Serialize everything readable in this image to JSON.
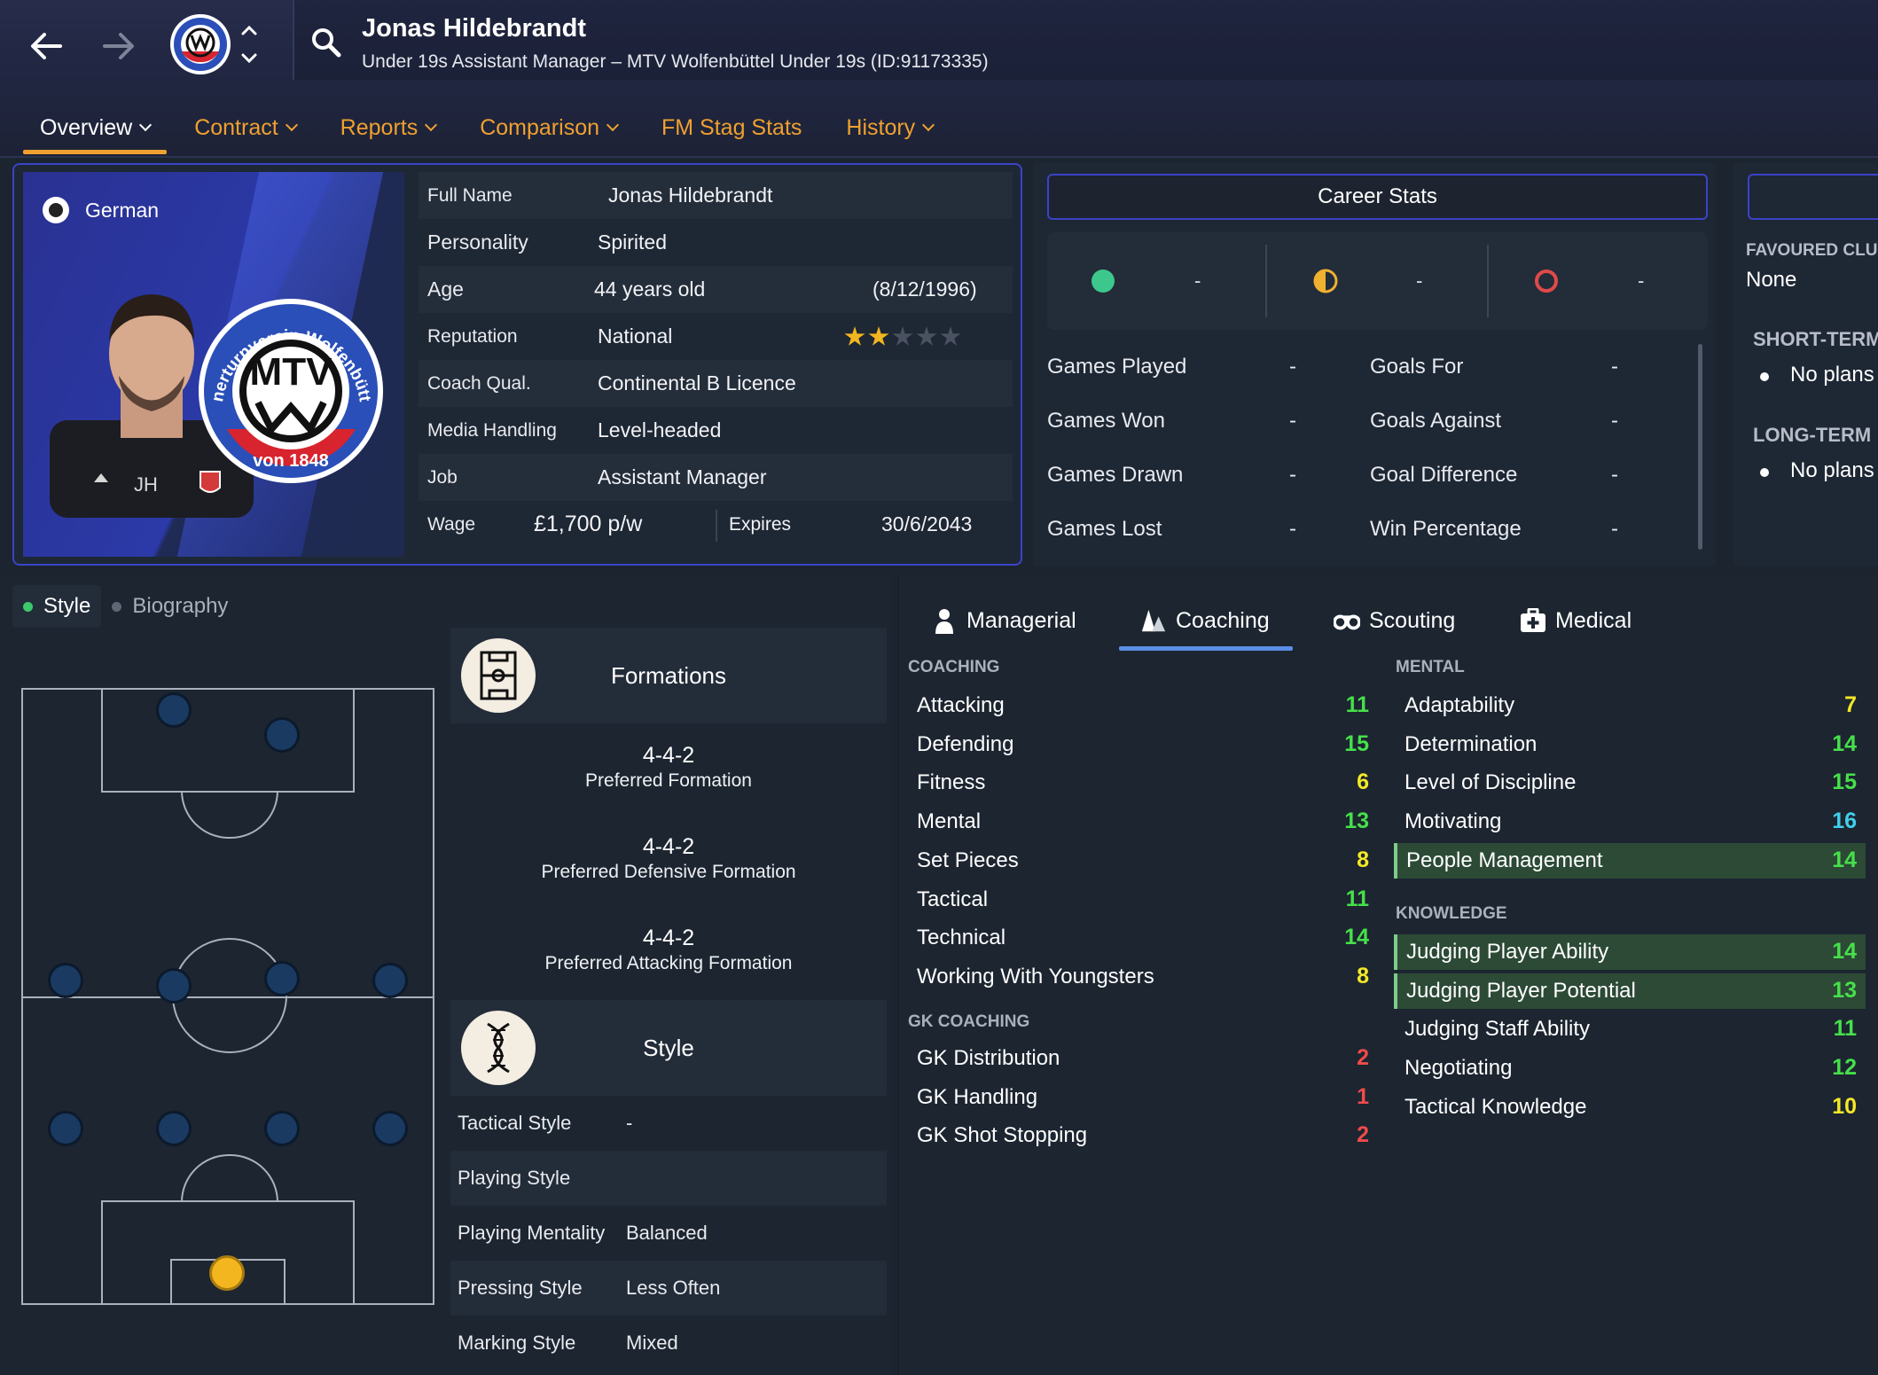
{
  "header": {
    "person_name": "Jonas Hildebrandt",
    "subtitle": "Under 19s Assistant Manager – MTV Wolfenbüttel Under 19s (ID:91173335)",
    "tabs": [
      {
        "label": "Overview",
        "dropdown": true,
        "active": true
      },
      {
        "label": "Contract",
        "dropdown": true
      },
      {
        "label": "Reports",
        "dropdown": true
      },
      {
        "label": "Comparison",
        "dropdown": true
      },
      {
        "label": "FM Stag Stats",
        "dropdown": false
      },
      {
        "label": "History",
        "dropdown": true
      }
    ],
    "accent": "#f0a030"
  },
  "profile": {
    "nationality": "German",
    "initials": "JH",
    "crest_top_text": "nerturnverein Wolfenbüttel e.V.",
    "crest_letters": "MTV",
    "crest_year": "von 1848",
    "rows": {
      "full_name_label": "Full Name",
      "full_name": "Jonas Hildebrandt",
      "personality_label": "Personality",
      "personality": "Spirited",
      "age_label": "Age",
      "age": "44 years old",
      "dob": "(8/12/1996)",
      "reputation_label": "Reputation",
      "reputation": "National",
      "reputation_stars": 2,
      "coach_qual_label": "Coach Qual.",
      "coach_qual": "Continental B Licence",
      "media_label": "Media Handling",
      "media": "Level-headed",
      "job_label": "Job",
      "job": "Assistant Manager",
      "wage_label": "Wage",
      "wage": "£1,700 p/w",
      "expires_label": "Expires",
      "expires": "30/6/2043"
    }
  },
  "career": {
    "title": "Career Stats",
    "results": [
      {
        "icon": "win-circle-icon",
        "color": "#3cc88c",
        "value": "-"
      },
      {
        "icon": "draw-circle-icon",
        "color": "#f0b030",
        "value": "-"
      },
      {
        "icon": "loss-circle-icon",
        "color": "#e04a4a",
        "value": "-"
      }
    ],
    "stats": [
      {
        "left_label": "Games Played",
        "left_value": "-",
        "right_label": "Goals For",
        "right_value": "-"
      },
      {
        "left_label": "Games Won",
        "left_value": "-",
        "right_label": "Goals Against",
        "right_value": "-"
      },
      {
        "left_label": "Games Drawn",
        "left_value": "-",
        "right_label": "Goal Difference",
        "right_value": "-"
      },
      {
        "left_label": "Games Lost",
        "left_value": "-",
        "right_label": "Win Percentage",
        "right_value": "-"
      }
    ]
  },
  "side": {
    "favoured_label": "FAVOURED CLUB",
    "favoured_value": "None",
    "short_label": "SHORT-TERM",
    "short_value": "No plans",
    "long_label": "LONG-TERM",
    "long_value": "No plans"
  },
  "style_tabs": [
    {
      "label": "Style",
      "active": true
    },
    {
      "label": "Biography",
      "active": false
    }
  ],
  "formations": {
    "title": "Formations",
    "items": [
      {
        "formation": "4-4-2",
        "desc": "Preferred Formation"
      },
      {
        "formation": "4-4-2",
        "desc": "Preferred Defensive Formation"
      },
      {
        "formation": "4-4-2",
        "desc": "Preferred Attacking Formation"
      }
    ]
  },
  "style": {
    "title": "Style",
    "rows": [
      {
        "label": "Tactical Style",
        "value": "-"
      },
      {
        "label": "Playing Style",
        "value": ""
      },
      {
        "label": "Playing Mentality",
        "value": "Balanced"
      },
      {
        "label": "Pressing Style",
        "value": "Less Often"
      },
      {
        "label": "Marking Style",
        "value": "Mixed"
      }
    ]
  },
  "attributes": {
    "tabs": [
      {
        "label": "Managerial",
        "icon": "person-icon"
      },
      {
        "label": "Coaching",
        "icon": "cones-icon",
        "active": true
      },
      {
        "label": "Scouting",
        "icon": "binoculars-icon"
      },
      {
        "label": "Medical",
        "icon": "medical-kit-icon"
      }
    ],
    "coaching_title": "COACHING",
    "coaching": [
      {
        "name": "Attacking",
        "value": 11
      },
      {
        "name": "Defending",
        "value": 15
      },
      {
        "name": "Fitness",
        "value": 6
      },
      {
        "name": "Mental",
        "value": 13
      },
      {
        "name": "Set Pieces",
        "value": 8
      },
      {
        "name": "Tactical",
        "value": 11
      },
      {
        "name": "Technical",
        "value": 14
      },
      {
        "name": "Working With Youngsters",
        "value": 8
      }
    ],
    "gk_title": "GK COACHING",
    "gk": [
      {
        "name": "GK Distribution",
        "value": 2
      },
      {
        "name": "GK Handling",
        "value": 1
      },
      {
        "name": "GK Shot Stopping",
        "value": 2
      }
    ],
    "mental_title": "MENTAL",
    "mental": [
      {
        "name": "Adaptability",
        "value": 7
      },
      {
        "name": "Determination",
        "value": 14
      },
      {
        "name": "Level of Discipline",
        "value": 15
      },
      {
        "name": "Motivating",
        "value": 16
      },
      {
        "name": "People Management",
        "value": 14,
        "highlight": true
      }
    ],
    "knowledge_title": "KNOWLEDGE",
    "knowledge": [
      {
        "name": "Judging Player Ability",
        "value": 14,
        "highlight": true
      },
      {
        "name": "Judging Player Potential",
        "value": 13,
        "highlight": true
      },
      {
        "name": "Judging Staff Ability",
        "value": 11
      },
      {
        "name": "Negotiating",
        "value": 12
      },
      {
        "name": "Tactical Knowledge",
        "value": 10
      }
    ]
  }
}
